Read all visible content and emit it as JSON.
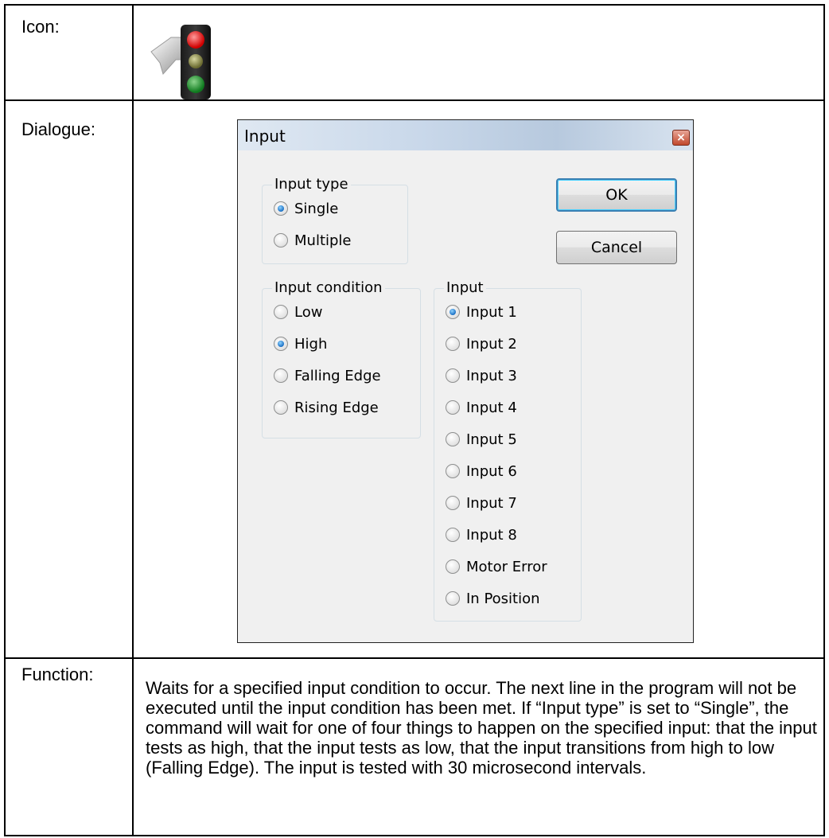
{
  "rows": {
    "icon_label": "Icon:",
    "dialogue_label": "Dialogue:",
    "function_label": "Function:"
  },
  "icon": {
    "name": "traffic-light-icon"
  },
  "dialog": {
    "title": "Input",
    "close_glyph": "×",
    "input_type": {
      "title": "Input type",
      "options": [
        {
          "label": "Single",
          "checked": true
        },
        {
          "label": "Multiple",
          "checked": false
        }
      ]
    },
    "input_condition": {
      "title": "Input condition",
      "options": [
        {
          "label": "Low",
          "checked": false
        },
        {
          "label": "High",
          "checked": true
        },
        {
          "label": "Falling Edge",
          "checked": false
        },
        {
          "label": "Rising Edge",
          "checked": false
        }
      ]
    },
    "input": {
      "title": "Input",
      "options": [
        {
          "label": "Input 1",
          "checked": true
        },
        {
          "label": "Input 2",
          "checked": false
        },
        {
          "label": "Input 3",
          "checked": false
        },
        {
          "label": "Input 4",
          "checked": false
        },
        {
          "label": "Input 5",
          "checked": false
        },
        {
          "label": "Input 6",
          "checked": false
        },
        {
          "label": "Input 7",
          "checked": false
        },
        {
          "label": "Input 8",
          "checked": false
        },
        {
          "label": "Motor Error",
          "checked": false
        },
        {
          "label": "In Position",
          "checked": false
        }
      ]
    },
    "ok_label": "OK",
    "cancel_label": "Cancel"
  },
  "function_text": "Waits for a specified input condition to occur. The next line in the program will not be executed until the input condition has been met. If “Input type” is set to “Single”, the command will wait for one of four things to happen on the specified input: that the input tests as high, that the input tests as low, that the input transitions from high to low (Falling Edge). The input is tested with 30 microsecond intervals."
}
